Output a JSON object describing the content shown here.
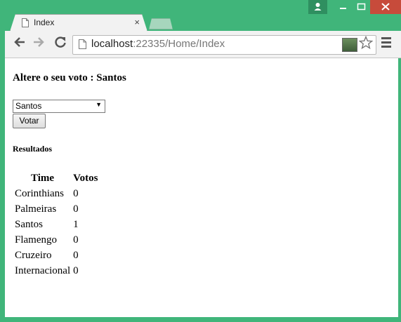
{
  "window": {
    "tab_title": "Index",
    "tab_close": "×"
  },
  "toolbar": {
    "url_host": "localhost",
    "url_rest": ":22335/Home/Index"
  },
  "page": {
    "heading": "Altere o seu voto : Santos",
    "select_value": "Santos",
    "vote_button": "Votar",
    "results_title": "Resultados",
    "columns": [
      "Time",
      "Votos"
    ],
    "rows": [
      {
        "team": "Corinthians",
        "votes": "0"
      },
      {
        "team": "Palmeiras",
        "votes": "0"
      },
      {
        "team": "Santos",
        "votes": "1"
      },
      {
        "team": "Flamengo",
        "votes": "0"
      },
      {
        "team": "Cruzeiro",
        "votes": "0"
      },
      {
        "team": "Internacional",
        "votes": "0"
      }
    ]
  },
  "icons": [
    "page-icon",
    "back-icon",
    "forward-icon",
    "reload-icon",
    "star-icon",
    "menu-icon",
    "user-icon"
  ]
}
